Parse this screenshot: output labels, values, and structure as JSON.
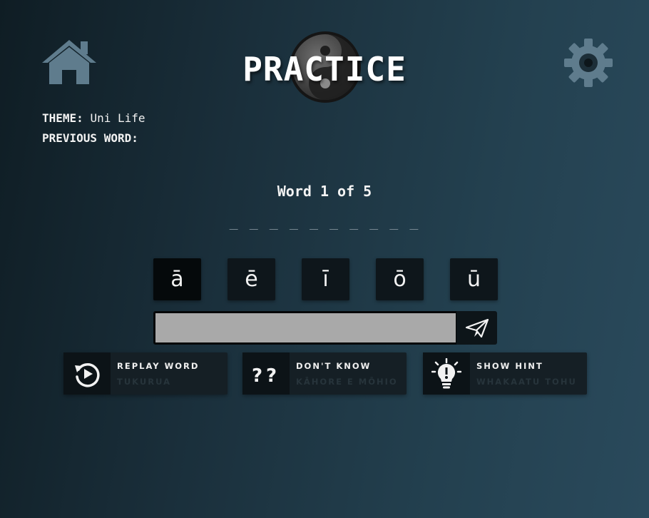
{
  "header": {
    "title": "PRACTICE",
    "home_icon": "home-icon",
    "settings_icon": "gear-icon",
    "logo_icon": "yin-yang-icon"
  },
  "info": {
    "theme_label": "THEME:",
    "theme_value": "Uni Life",
    "previous_word_label": "PREVIOUS WORD:",
    "previous_word_value": ""
  },
  "progress": {
    "text": "Word 1 of 5",
    "blanks": "_ _ _ _ _ _ _ _ _ _"
  },
  "macron_keys": [
    "ā",
    "ē",
    "ī",
    "ō",
    "ū"
  ],
  "answer": {
    "value": "",
    "placeholder": "",
    "send_icon": "paper-plane-icon"
  },
  "actions": {
    "replay": {
      "label": "REPLAY WORD",
      "sublabel": "TUKURUA",
      "icon": "replay-icon"
    },
    "dont_know": {
      "label": "DON'T KNOW",
      "sublabel": "KĀHORE E MŌHIO",
      "icon": "question-marks-icon"
    },
    "hint": {
      "label": "SHOW HINT",
      "sublabel": "WHAKAATU TOHU",
      "icon": "lightbulb-icon"
    }
  },
  "colors": {
    "background_start": "#0f1d24",
    "background_end": "#2a4a5c",
    "icon_gray": "#5f7c8d",
    "input_fill": "#a9a9a9"
  }
}
